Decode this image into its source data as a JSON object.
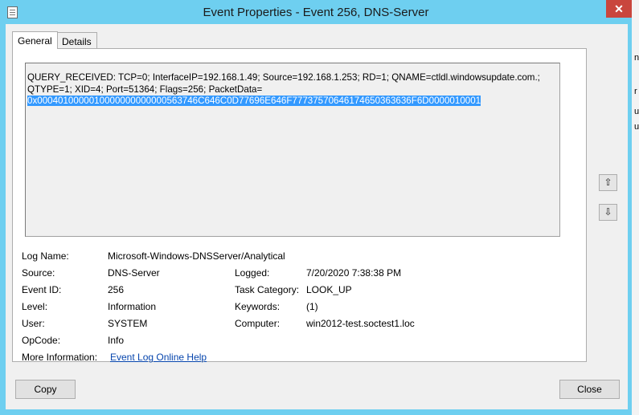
{
  "window": {
    "title": "Event Properties - Event 256, DNS-Server",
    "close_glyph": "✕"
  },
  "tabs": [
    {
      "label": "General"
    },
    {
      "label": "Details"
    }
  ],
  "description": {
    "line1": "QUERY_RECEIVED: TCP=0; InterfaceIP=192.168.1.49; Source=192.168.1.253; RD=1; QNAME=ctldl.windowsupdate.com.;",
    "line2": "QTYPE=1; XID=4; Port=51364; Flags=256; PacketData=",
    "packet_data": "0x0004010000010000000000000563746C646C0D77696E646F77737570646174650363636F6D0000010001"
  },
  "fields": {
    "log_name": {
      "label": "Log Name:",
      "value": "Microsoft-Windows-DNSServer/Analytical"
    },
    "source": {
      "label": "Source:",
      "value": "DNS-Server"
    },
    "logged": {
      "label": "Logged:",
      "value": "7/20/2020 7:38:38 PM"
    },
    "event_id": {
      "label": "Event ID:",
      "value": "256"
    },
    "task_category": {
      "label": "Task Category:",
      "value": "LOOK_UP"
    },
    "level": {
      "label": "Level:",
      "value": "Information"
    },
    "keywords": {
      "label": "Keywords:",
      "value": "(1)"
    },
    "user": {
      "label": "User:",
      "value": "SYSTEM"
    },
    "computer": {
      "label": "Computer:",
      "value": "win2012-test.soctest1.loc"
    },
    "opcode": {
      "label": "OpCode:",
      "value": "Info"
    },
    "more_info": {
      "label": "More Information:",
      "value": "Event Log Online Help"
    }
  },
  "nav": {
    "up_glyph": "⇧",
    "down_glyph": "⇩"
  },
  "buttons": {
    "copy": "Copy",
    "close": "Close"
  },
  "background_fragments": [
    "n",
    "r",
    "u",
    "u"
  ]
}
